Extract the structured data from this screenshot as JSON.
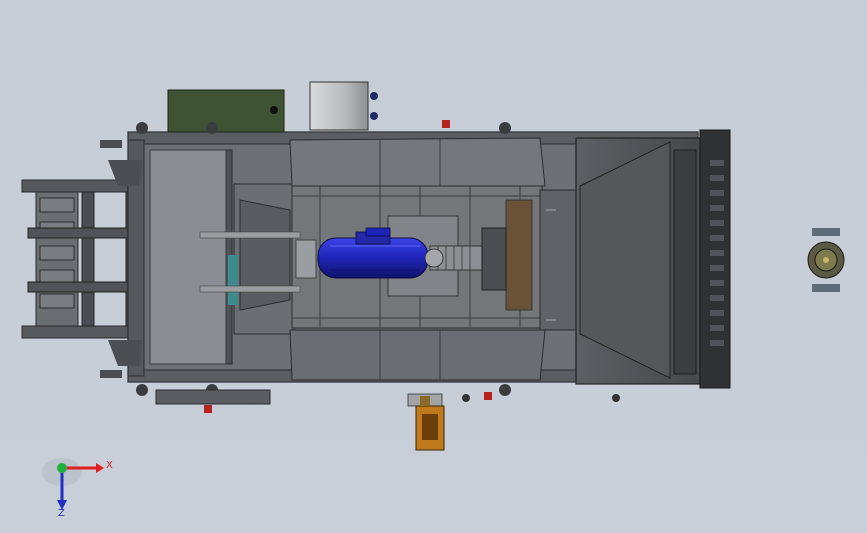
{
  "viewport": {
    "background_top": "#c6cdd7",
    "background_bottom": "#c9cfd8"
  },
  "model": {
    "frame_color": "#5b5e63",
    "frame_dark": "#3a3c40",
    "panel_color": "#6b6e73",
    "hopper_color": "#4e5054",
    "motor_color": "#1f24b8",
    "motor_highlight": "#3b44e6",
    "control_box_color": "#3d5334",
    "drive_box_color": "#b8babc",
    "accent_red": "#b4231e",
    "accent_orange": "#c07a1c"
  },
  "triad": {
    "x_label": "X",
    "z_label": "Z",
    "x_color": "#e02020",
    "y_color": "#20b040",
    "z_color": "#2030c0"
  }
}
